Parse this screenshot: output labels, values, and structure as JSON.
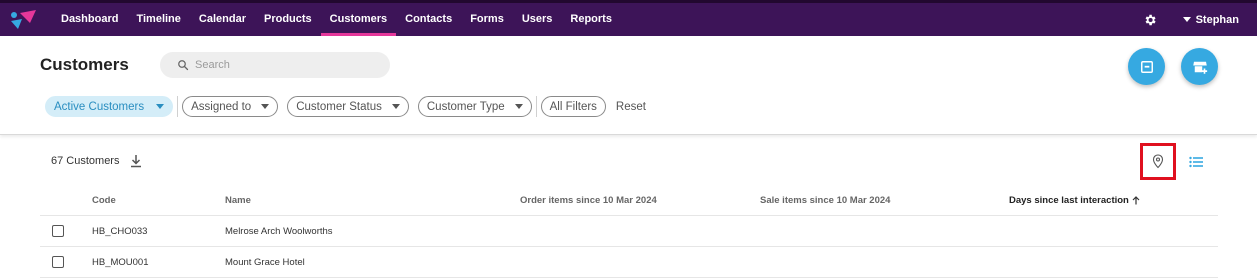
{
  "nav": {
    "items": [
      {
        "label": "Dashboard",
        "active": false
      },
      {
        "label": "Timeline",
        "active": false
      },
      {
        "label": "Calendar",
        "active": false
      },
      {
        "label": "Products",
        "active": false
      },
      {
        "label": "Customers",
        "active": true
      },
      {
        "label": "Contacts",
        "active": false
      },
      {
        "label": "Forms",
        "active": false
      },
      {
        "label": "Users",
        "active": false
      },
      {
        "label": "Reports",
        "active": false
      }
    ],
    "user": "Stephan",
    "icons": {
      "settings": "gear-icon",
      "user_menu": "caret-down-icon"
    }
  },
  "header": {
    "title": "Customers",
    "search_placeholder": "Search"
  },
  "filters": {
    "active": "Active Customers",
    "chips": [
      "Assigned to",
      "Customer Status",
      "Customer Type"
    ],
    "all_filters": "All Filters",
    "reset": "Reset"
  },
  "list": {
    "count": "67 Customers",
    "columns": {
      "code": "Code",
      "name": "Name",
      "orders": "Order items since 10 Mar 2024",
      "sales": "Sale items since 10 Mar 2024",
      "days": "Days since last interaction"
    },
    "rows": [
      {
        "code": "HB_CHO033",
        "name": "Melrose Arch Woolworths"
      },
      {
        "code": "HB_MOU001",
        "name": "Mount Grace Hotel"
      }
    ]
  },
  "colors": {
    "nav_bg": "#3d1458",
    "nav_active": "#e5379a",
    "accent": "#36a9e1",
    "highlight": "#e0101f"
  }
}
